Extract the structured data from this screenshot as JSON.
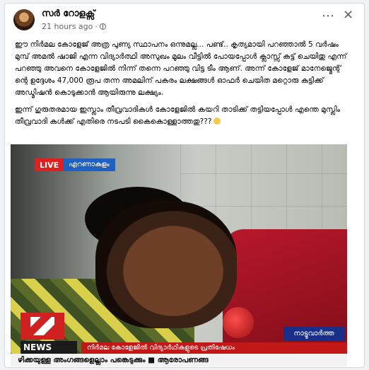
{
  "post": {
    "author": "സർ റോളക്സ്",
    "timestamp": "21 hours ago",
    "paragraph1": "ഈ നിർമല കോളേജ് അത്ര പുണ്യ സ്ഥാപനം ഒന്നുമല്ല... പണ്ട്.. കൃത്യമായി പറഞ്ഞാൽ 5 വർഷം മുമ്പ് അമൽ ഷാജി എന്ന വിദ്യാർത്ഥി അസുഖം മൂലം വീട്ടിൽ പോയപ്പോൾ ക്ലാസ്സ്‌ കട്ട് ചെയിതു എന്ന് പറഞ്ഞു അവനെ കോളേജിൽ നിന്ന് തന്നെ പറഞ്ഞു വിട്ട ടീം ആണ്. അന്ന് കോളേജ് മാനേജ്മെന്റ് ന്റെ ഉദ്ദേശം 47,000 രൂപ തന്ന അമലിന് പകരം ലക്ഷങ്ങൾ ഓഫർ ചെയിത മറ്റൊരു കുട്ടിക്ക് അഡ്മിഷൻ കൊടുക്കാൻ ആയിരുന്നു ലക്ഷ്യം.",
    "paragraph2": "ഇന്ന് ഗുരുതരമായ ഇസ്ലാം തീവ്രവാദികൾ കോളേജിൽ കയറി താടിക്ക് തട്ടിയപ്പോൾ എന്തെ മുസ്ലിം തീവ്രവാദി കൾക്ക് എതിരെ നടപടി കൈകൊള്ളാത്തതു???"
  },
  "video": {
    "live_label": "LIVE",
    "location": "എറണാകുളം",
    "channel_news": "NEWS",
    "segment_tag": "നാട്ടുവാർത്ത",
    "headline": "നിർമല കോളേജിൽ വിദ്യാർഥികളുടെ പ്രതിഷേധം",
    "ticker": "ഴിക്കയുള്ള അംഗങ്ങളെല്ലാം പങ്കെടുക്കും  ■  ആരോപണങ്ങ"
  },
  "icons": [
    "globe-icon",
    "more-options-icon",
    "close-icon",
    "emoji-icon"
  ]
}
